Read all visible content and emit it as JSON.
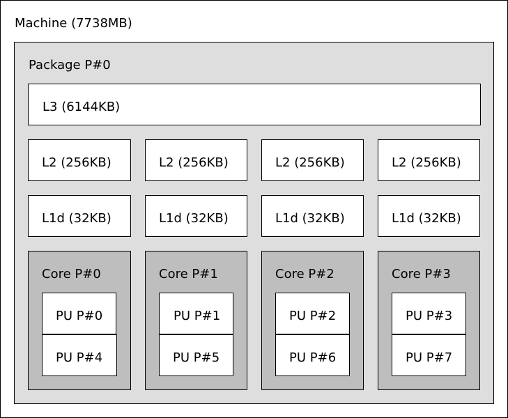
{
  "machine": {
    "label": "Machine (7738MB)"
  },
  "package": {
    "label": "Package P#0"
  },
  "l3": {
    "label": "L3 (6144KB)"
  },
  "l2": [
    "L2 (256KB)",
    "L2 (256KB)",
    "L2 (256KB)",
    "L2 (256KB)"
  ],
  "l1d": [
    "L1d (32KB)",
    "L1d (32KB)",
    "L1d (32KB)",
    "L1d (32KB)"
  ],
  "cores": [
    {
      "label": "Core P#0",
      "pus": [
        "PU P#0",
        "PU P#4"
      ]
    },
    {
      "label": "Core P#1",
      "pus": [
        "PU P#1",
        "PU P#5"
      ]
    },
    {
      "label": "Core P#2",
      "pus": [
        "PU P#2",
        "PU P#6"
      ]
    },
    {
      "label": "Core P#3",
      "pus": [
        "PU P#3",
        "PU P#7"
      ]
    }
  ],
  "colors": {
    "machine_bg": "#ffffff",
    "package_bg": "#dedede",
    "cache_bg": "#ffffff",
    "core_bg": "#bebebe",
    "pu_bg": "#ffffff",
    "border": "#000000"
  }
}
